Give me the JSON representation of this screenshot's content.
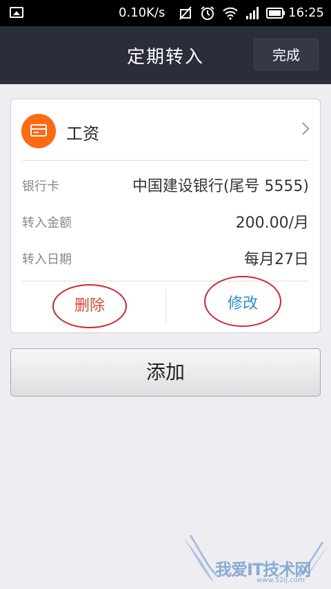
{
  "status_bar": {
    "net_speed": "0.10K/s",
    "time": "16:25",
    "icons": [
      "image-icon",
      "no-signal-icon",
      "alarm-icon",
      "wifi-icon",
      "cell-signal-icon",
      "battery-icon"
    ]
  },
  "header": {
    "title": "定期转入",
    "done_label": "完成"
  },
  "card": {
    "title": "工资",
    "rows": [
      {
        "label": "银行卡",
        "value": "中国建设银行(尾号 5555)"
      },
      {
        "label": "转入金额",
        "value": "200.00/月"
      },
      {
        "label": "转入日期",
        "value": "每月27日"
      }
    ],
    "delete_label": "删除",
    "edit_label": "修改"
  },
  "add_label": "添加",
  "watermark": {
    "text": "我爱IT技术网",
    "sub": "www.52ij.com"
  },
  "colors": {
    "accent_orange": "#ff6a13",
    "title_bar": "#2a2d3a",
    "delete_red": "#e24a2c",
    "edit_blue": "#2a8fd6",
    "annotation_red": "#d8232a"
  }
}
